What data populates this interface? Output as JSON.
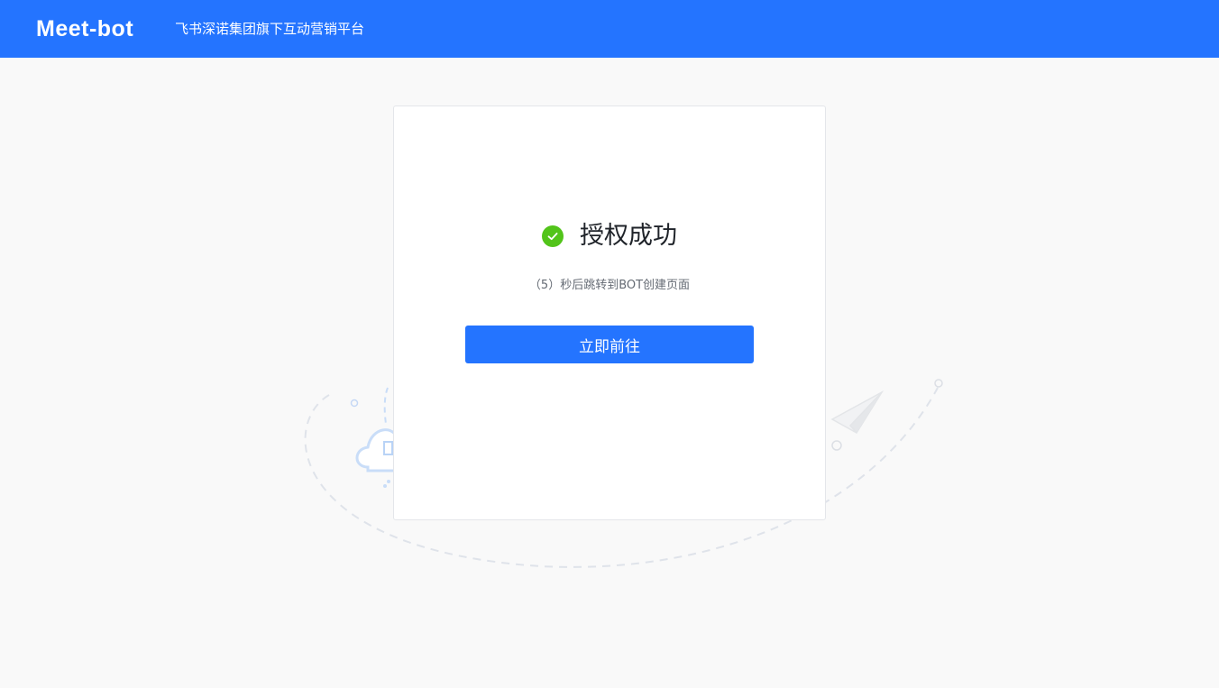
{
  "header": {
    "logo_text": "Meet-bot",
    "tagline": "飞书深诺集团旗下互动营销平台"
  },
  "card": {
    "status_icon": "check-circle-icon",
    "status_title": "授权成功",
    "countdown_text": "（5）秒后跳转到BOT创建页面",
    "go_button_label": "立即前往"
  },
  "colors": {
    "brand_blue": "#2474ff",
    "success_green": "#52c41a",
    "page_bg": "#f9f9f9"
  }
}
